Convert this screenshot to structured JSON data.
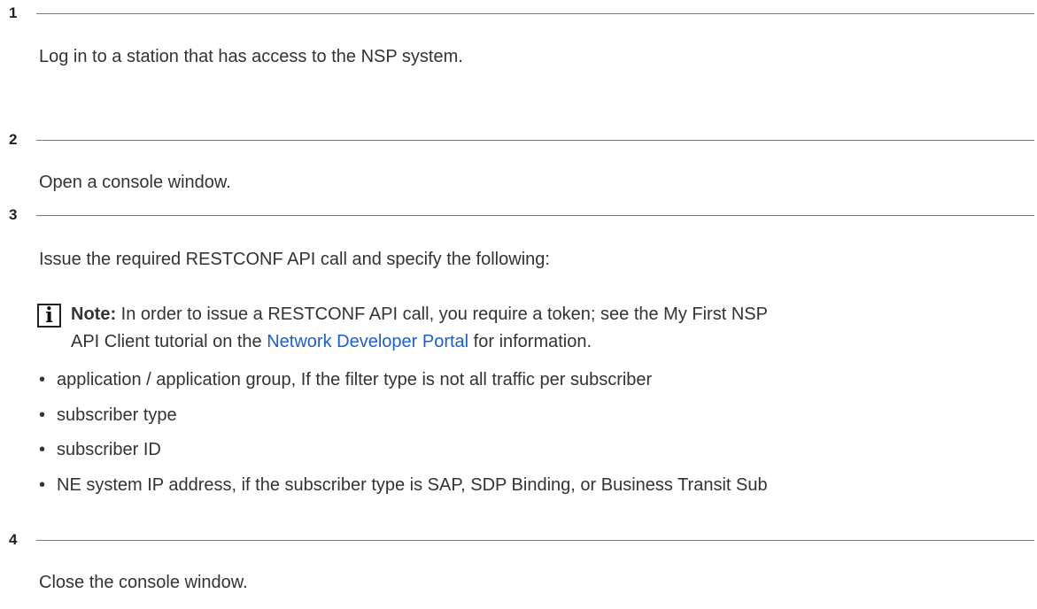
{
  "steps": [
    {
      "number": "1",
      "text": "Log in to a station that has access to the NSP system."
    },
    {
      "number": "2",
      "text": "Open a console window."
    },
    {
      "number": "3",
      "text": "Issue the required RESTCONF API call and specify the following:"
    },
    {
      "number": "4",
      "text": "Close the console window."
    }
  ],
  "note": {
    "icon": "info-icon",
    "icon_glyph": "i",
    "label": "Note:",
    "text_before": "In order to issue a RESTCONF API call, you require a token; see the My First NSP",
    "line2_before": "API Client tutorial on the ",
    "link_text": "Network Developer Portal",
    "line2_after": " for information.",
    "link_color": "#1a5fd6"
  },
  "bullets": [
    "application / application group, If the filter type is not all traffic per subscriber",
    "subscriber type",
    "subscriber ID",
    "NE system IP address, if the subscriber type is SAP, SDP Binding, or Business Transit Sub"
  ],
  "bullet_glyph": "•"
}
